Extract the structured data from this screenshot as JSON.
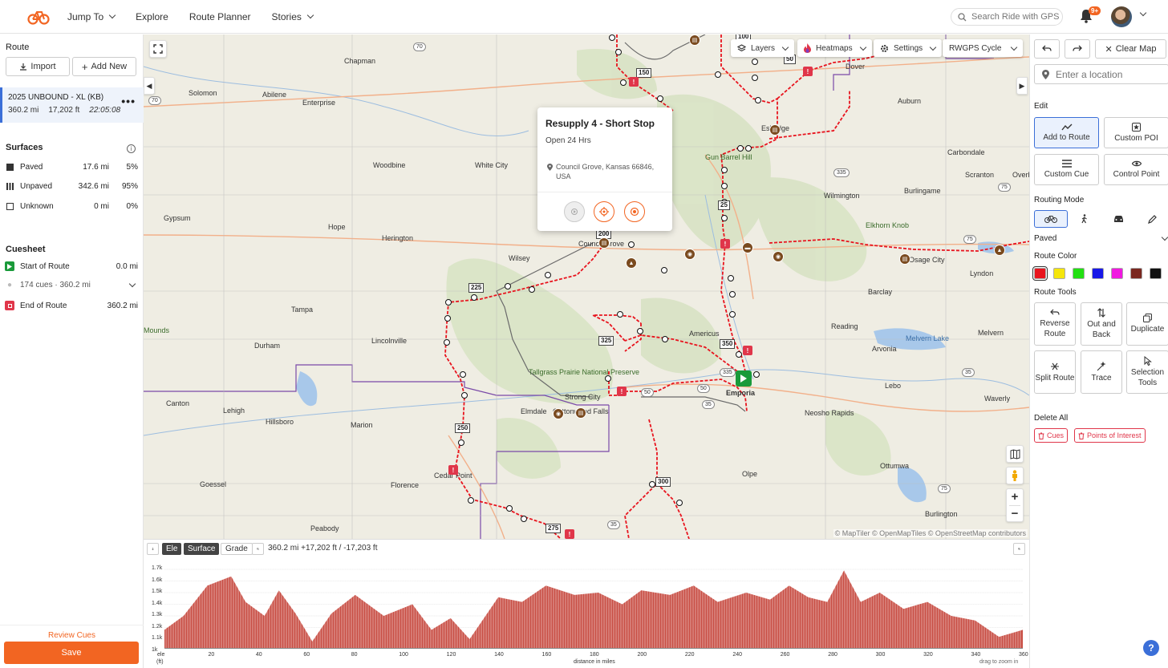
{
  "nav": {
    "jump_to": "Jump To",
    "explore": "Explore",
    "route_planner": "Route Planner",
    "stories": "Stories",
    "search_placeholder": "Search Ride with GPS",
    "notification_badge": "9+"
  },
  "left": {
    "route_title": "Route",
    "import_label": "Import",
    "add_new_label": "Add New",
    "route": {
      "name": "2025 UNBOUND - XL (KB)",
      "distance": "360.2 mi",
      "elevation": "17,202 ft",
      "time": "22:05:08"
    },
    "surfaces_title": "Surfaces",
    "surfaces": [
      {
        "label": "Paved",
        "miles": "17.6 mi",
        "pct": "5%"
      },
      {
        "label": "Unpaved",
        "miles": "342.6 mi",
        "pct": "95%"
      },
      {
        "label": "Unknown",
        "miles": "0 mi",
        "pct": "0%"
      }
    ],
    "cuesheet_title": "Cuesheet",
    "start_label": "Start of Route",
    "start_value": "0.0 mi",
    "cues_summary": "174 cues · 360.2 mi",
    "end_label": "End of Route",
    "end_value": "360.2 mi",
    "review_cues": "Review Cues",
    "save": "Save"
  },
  "map": {
    "layers": "Layers",
    "heatmaps": "Heatmaps",
    "settings": "Settings",
    "basemap": "RWGPS Cycle",
    "popup": {
      "title": "Resupply 4 - Short Stop",
      "subtitle": "Open 24 Hrs",
      "address": "Council Grove, Kansas 66846, USA"
    },
    "attribution": "© MapTiler © OpenMapTiles © OpenStreetMap contributors",
    "zoom_in": "+",
    "zoom_out": "−",
    "towns": {
      "chapman": "Chapman",
      "solomon": "Solomon",
      "abilene": "Abilene",
      "enterprise": "Enterprise",
      "woodbine": "Woodbine",
      "white_city": "White City",
      "gypsum": "Gypsum",
      "hope": "Hope",
      "herington": "Herington",
      "wilsey": "Wilsey",
      "council_grove": "Council Grove",
      "tampa": "Tampa",
      "durham": "Durham",
      "lincolnville": "Lincolnville",
      "tallgrass": "Tallgrass Prairie National Preserve",
      "strong_city": "Strong City",
      "elmdale": "Elmdale",
      "cottonwood_falls": "Cottonwood Falls",
      "canton": "Canton",
      "lehigh": "Lehigh",
      "hillsboro": "Hillsboro",
      "marion": "Marion",
      "goessel": "Goessel",
      "florence": "Florence",
      "cedar_point": "Cedar Point",
      "peabody": "Peabody",
      "mounds": "Mounds",
      "dover": "Dover",
      "auburn": "Auburn",
      "eskridge": "Eskridge",
      "carbondale": "Carbondale",
      "gun_barrel_hill": "Gun Barrel Hill",
      "wilmington": "Wilmington",
      "burlingame": "Burlingame",
      "scranton": "Scranton",
      "overbrook": "Overb",
      "elkhorn_knob": "Elkhorn Knob",
      "osage_city": "Osage City",
      "lyndon": "Lyndon",
      "barclay": "Barclay",
      "reading": "Reading",
      "americus": "Americus",
      "arvonia": "Arvonia",
      "melvern_lake": "Melvern Lake",
      "melvern": "Melvern",
      "emporia": "Emporia",
      "lebo": "Lebo",
      "waverly": "Waverly",
      "neosho_rapids": "Neosho Rapids",
      "olpe": "Olpe",
      "ottumwa": "Ottumwa",
      "burlington": "Burlington"
    },
    "miles": [
      "100",
      "150",
      "50",
      "25",
      "200",
      "225",
      "325",
      "350",
      "250",
      "300",
      "275"
    ],
    "highways": [
      "70",
      "70",
      "335",
      "75",
      "75",
      "50",
      "50",
      "35",
      "35",
      "35",
      "335",
      "75"
    ]
  },
  "elevation": {
    "tab_ele": "Ele",
    "tab_surface": "Surface",
    "tab_grade": "Grade",
    "stats": "360.2 mi +17,202 ft / -17,203 ft",
    "y_ticks": [
      "1.7k",
      "1.6k",
      "1.5k",
      "1.4k",
      "1.3k",
      "1.2k",
      "1.1k",
      "1k"
    ],
    "x_ticks": [
      "20",
      "40",
      "60",
      "80",
      "100",
      "120",
      "140",
      "160",
      "180",
      "200",
      "220",
      "240",
      "260",
      "280",
      "300",
      "320",
      "340",
      "360"
    ],
    "y_unit_top": "ele",
    "y_unit": "(ft)",
    "x_label": "distance in miles",
    "hint": "drag to zoom in"
  },
  "right": {
    "clear_map": "Clear Map",
    "location_placeholder": "Enter a location",
    "edit_title": "Edit",
    "add_to_route": "Add to Route",
    "custom_poi": "Custom POI",
    "custom_cue": "Custom Cue",
    "control_point": "Control Point",
    "routing_mode_title": "Routing Mode",
    "routing_surface": "Paved",
    "route_color_title": "Route Color",
    "colors": [
      "#e8141e",
      "#f5e60c",
      "#22e012",
      "#1818e8",
      "#f018e0",
      "#7a2820",
      "#111111"
    ],
    "route_tools_title": "Route Tools",
    "reverse_route": "Reverse Route",
    "out_and_back": "Out and Back",
    "duplicate": "Duplicate",
    "split_route": "Split Route",
    "trace": "Trace",
    "selection_tools": "Selection Tools",
    "delete_all_title": "Delete All",
    "delete_cues": "Cues",
    "delete_pois": "Points of Interest",
    "help": "?"
  }
}
